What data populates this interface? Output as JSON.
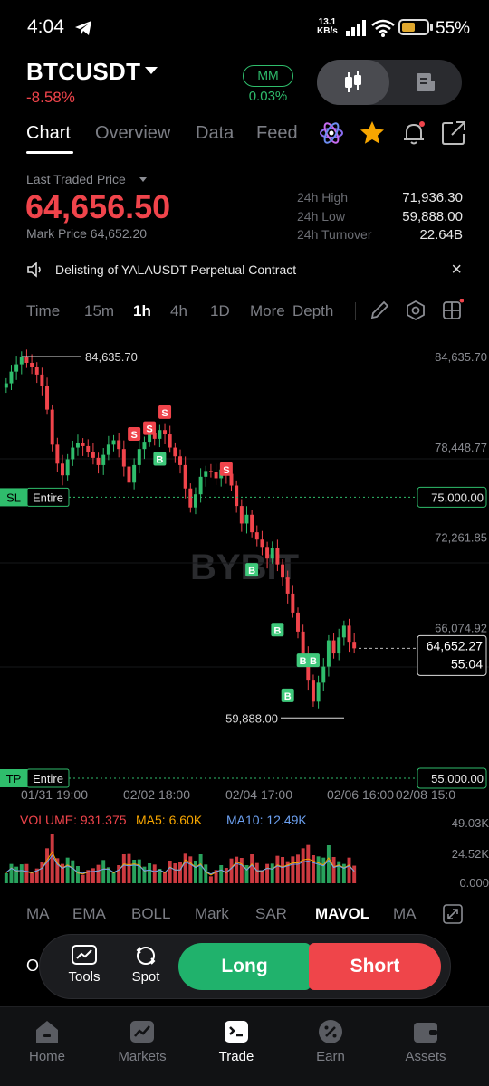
{
  "status_bar": {
    "time": "4:04",
    "speed_value": "13.1",
    "speed_unit": "KB/s",
    "battery_percent": "55%",
    "battery_level": 0.55
  },
  "header": {
    "symbol": "BTCUSDT",
    "change": "-8.58%",
    "mm_label": "MM",
    "mm_value": "0.03%"
  },
  "tabs": [
    {
      "label": "Chart"
    },
    {
      "label": "Overview"
    },
    {
      "label": "Data"
    },
    {
      "label": "Feed"
    }
  ],
  "price": {
    "ltp_label": "Last Traded Price",
    "ltp": "64,656.50",
    "mark_price": "Mark Price 64,652.20",
    "stats": [
      {
        "label": "24h High",
        "value": "71,936.30"
      },
      {
        "label": "24h Low",
        "value": "59,888.00"
      },
      {
        "label": "24h Turnover",
        "value": "22.64B"
      }
    ]
  },
  "notice": {
    "text": "Delisting of YALAUSDT Perpetual Contract"
  },
  "intervals": [
    "Time",
    "15m",
    "1h",
    "4h",
    "1D",
    "More",
    "Depth"
  ],
  "chart_data": {
    "type": "candlestick",
    "watermark": "BYBIT",
    "y_ticks": [
      "84,635.70",
      "78,448.77",
      "72,261.85",
      "66,074.92"
    ],
    "y_range": [
      56000,
      85500
    ],
    "x_ticks": [
      "01/31 19:00",
      "02/02 18:00",
      "02/04 17:00",
      "02/06 16:00",
      "02/08 15:0"
    ],
    "high_label": "84,635.70",
    "low_label": "59,888.00",
    "current_price": "64,652.27",
    "countdown": "55:04",
    "sl": {
      "tag": "SL",
      "mode": "Entire",
      "price": "75,000.00"
    },
    "tp": {
      "tag": "TP",
      "mode": "Entire",
      "price": "55,000.00"
    },
    "close_series": [
      82800,
      83600,
      84100,
      84635.7,
      84200,
      83900,
      83400,
      82600,
      81000,
      78600,
      77300,
      76500,
      77600,
      78400,
      78700,
      78500,
      78100,
      77700,
      77200,
      77900,
      78600,
      78900,
      78300,
      77100,
      76000,
      77200,
      78300,
      78800,
      79400,
      79000,
      79600,
      79300,
      78400,
      77800,
      77200,
      75600,
      74300,
      75200,
      76400,
      76800,
      76700,
      76300,
      76900,
      76600,
      75800,
      74400,
      73200,
      73800,
      72600,
      72100,
      71600,
      70800,
      71500,
      70400,
      69500,
      68400,
      67100,
      65800,
      64200,
      62500,
      61000,
      62300,
      63400,
      65200,
      64300,
      65400,
      66200,
      65100,
      64652.27
    ],
    "trade_markers": [
      {
        "type": "S",
        "price": 79700,
        "index": 28
      },
      {
        "type": "S",
        "price": 79300,
        "index": 25
      },
      {
        "type": "S",
        "price": 80800,
        "index": 31
      },
      {
        "type": "B",
        "price": 77600,
        "index": 30
      },
      {
        "type": "S",
        "price": 76900,
        "index": 43
      },
      {
        "type": "B",
        "price": 70000,
        "index": 48
      },
      {
        "type": "B",
        "price": 65900,
        "index": 53
      },
      {
        "type": "B",
        "price": 63800,
        "index": 60
      },
      {
        "type": "B",
        "price": 61400,
        "index": 55
      },
      {
        "type": "B",
        "price": 63800,
        "index": 58
      }
    ],
    "volume": {
      "label": "VOLUME: 931.375",
      "ma5": "MA5: 6.60K",
      "ma10": "MA10: 12.49K",
      "y_ticks": [
        "49.03K",
        "24.52K",
        "0.000"
      ]
    }
  },
  "indicators": [
    "MA",
    "EMA",
    "BOLL",
    "Mark",
    "SAR",
    "MAVOL",
    "MA"
  ],
  "actions": {
    "tools": "Tools",
    "spot": "Spot",
    "long": "Long",
    "short": "Short",
    "peek": "O"
  },
  "bottom_nav": [
    {
      "label": "Home"
    },
    {
      "label": "Markets"
    },
    {
      "label": "Trade"
    },
    {
      "label": "Earn"
    },
    {
      "label": "Assets"
    }
  ],
  "colors": {
    "up": "#2fbd6c",
    "down": "#f0444b",
    "background": "#000000"
  }
}
